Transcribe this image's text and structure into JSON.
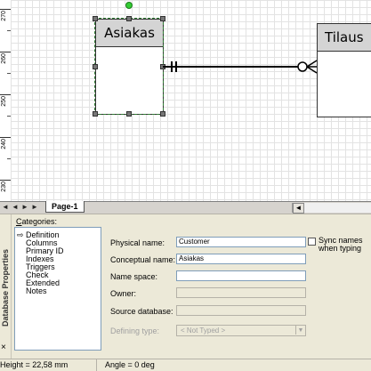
{
  "vruler": {
    "labels": [
      "270",
      "260",
      "250",
      "240",
      "230"
    ]
  },
  "diagram": {
    "entities": [
      {
        "title": "Asiakas"
      },
      {
        "title": "Tilaus"
      }
    ]
  },
  "tabs": {
    "nav_first": "◄",
    "nav_prev": "◄",
    "nav_next": "►",
    "nav_last": "►",
    "page_tab": "Page-1",
    "scroll_arrow": "◄"
  },
  "properties": {
    "window_title": "Database Properties",
    "close": "×",
    "categories_label": "Categories:",
    "categories": [
      "Definition",
      "Columns",
      "Primary ID",
      "Indexes",
      "Triggers",
      "Check",
      "Extended",
      "Notes"
    ],
    "fields": {
      "physical_name_label": "Physical name:",
      "physical_name_value": "Customer",
      "conceptual_name_label": "Conceptual name:",
      "conceptual_name_value": "Asiakas",
      "name_space_label": "Name space:",
      "name_space_value": "",
      "owner_label": "Owner:",
      "owner_value": "",
      "source_database_label": "Source database:",
      "source_database_value": "",
      "defining_type_label": "Defining type:",
      "defining_type_value": "<    Not Typed    >"
    },
    "sync_names_label": "Sync names when typing",
    "sync_names_checked": false
  },
  "status": {
    "height": "Height = 22,58 mm",
    "angle": "Angle = 0 deg"
  },
  "colors": {
    "selection": "#2e7d32",
    "rotation_handle": "#33cc33",
    "entity_header": "#d4d4d4",
    "panel_bg": "#ece9d8"
  }
}
